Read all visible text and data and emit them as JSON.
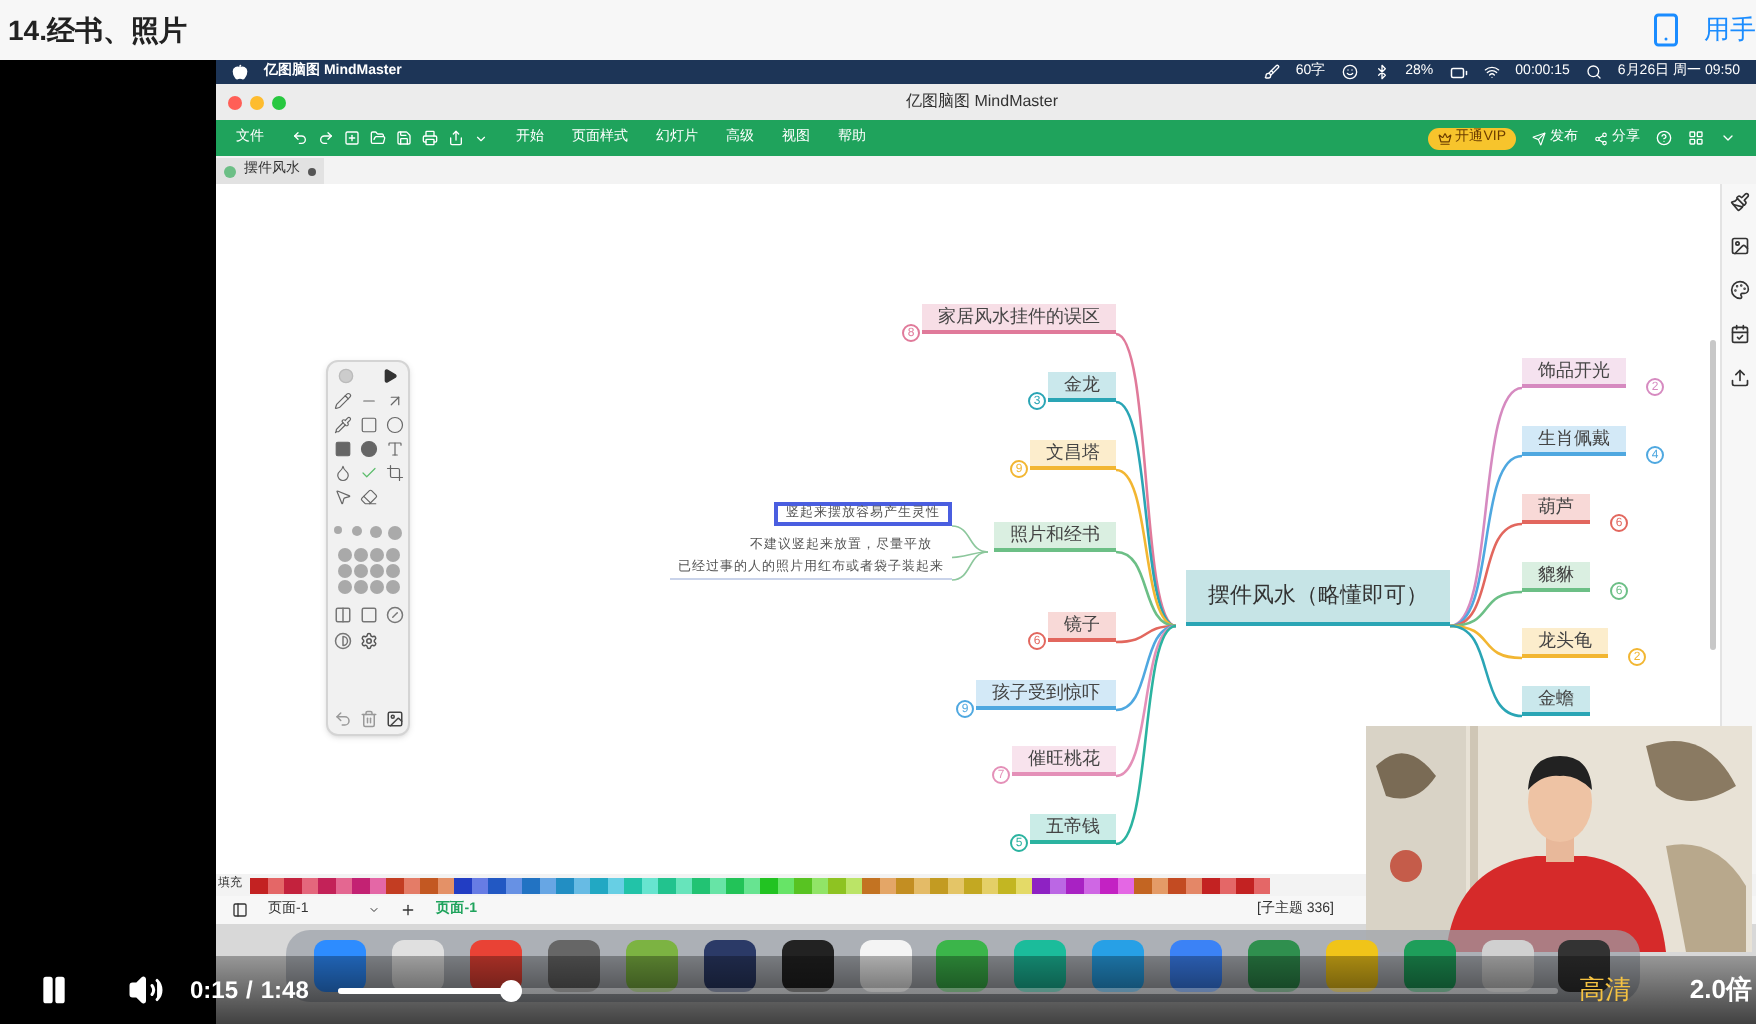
{
  "page": {
    "title": "14.经书、照片",
    "phone_link": "用手"
  },
  "mac_menubar": {
    "app_name": "亿图脑图 MindMaster",
    "word_count": "60字",
    "battery": "28%",
    "recording_time": "00:00:15",
    "datetime": "6月26日 周一 09:50"
  },
  "window": {
    "title": "亿图脑图 MindMaster"
  },
  "ribbon": {
    "file": "文件",
    "menus": [
      "开始",
      "页面样式",
      "幻灯片",
      "高级",
      "视图",
      "帮助"
    ],
    "vip": "开通VIP",
    "actions": [
      "发布",
      "分享"
    ]
  },
  "doc_tab": {
    "label": "摆件风水",
    "unsaved": true
  },
  "mindmap": {
    "central": "摆件风水（略懂即可）",
    "left_branches": [
      {
        "label": "家居风水挂件的误区",
        "badge": "8",
        "color": "#e07a9a"
      },
      {
        "label": "金龙",
        "badge": "3",
        "color": "#2aa5b5"
      },
      {
        "label": "文昌塔",
        "badge": "9",
        "color": "#f2b632"
      },
      {
        "label": "照片和经书",
        "color": "#6cbf86"
      },
      {
        "label": "镜子",
        "badge": "6",
        "color": "#e2675e"
      },
      {
        "label": "孩子受到惊吓",
        "badge": "9",
        "color": "#4fa8e0"
      },
      {
        "label": "催旺桃花",
        "badge": "7",
        "color": "#e490b8"
      },
      {
        "label": "五帝钱",
        "badge": "5",
        "color": "#2bb3a0"
      }
    ],
    "notes": [
      {
        "text": "竖起来摆放容易产生灵性",
        "selected": true
      },
      {
        "text": "不建议竖起来放置，尽量平放",
        "selected": false
      },
      {
        "text": "已经过事的人的照片用红布或者袋子装起来",
        "selected": false
      }
    ],
    "right_branches": [
      {
        "label": "饰品开光",
        "badge": "2",
        "color": "#d68ac0"
      },
      {
        "label": "生肖佩戴",
        "badge": "4",
        "color": "#4fa8e0"
      },
      {
        "label": "葫芦",
        "badge": "6",
        "color": "#e2675e"
      },
      {
        "label": "貔貅",
        "badge": "6",
        "color": "#6cbf86"
      },
      {
        "label": "龙头龟",
        "badge": "2",
        "color": "#f2b632"
      },
      {
        "label": "金蟾",
        "color": "#2aa5b5"
      }
    ]
  },
  "palette": {
    "label": "填充"
  },
  "status_bar": {
    "page_select": "页面-1",
    "page_tab": "页面-1",
    "topic_count": "[子主题 336]"
  },
  "player": {
    "current": "0:15",
    "separator": "/",
    "duration": "1:48",
    "level": 0.14,
    "quality": "高清",
    "speed": "2.0倍",
    "playing": true
  }
}
